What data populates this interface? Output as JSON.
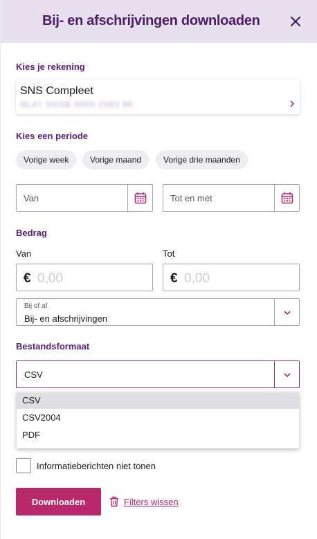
{
  "header": {
    "title": "Bij- en afschrijvingen downloaden",
    "close_icon": "close-icon"
  },
  "account": {
    "section_label": "Kies je rekening",
    "name": "SNS Compleet",
    "number_masked": "NL47 SNSB 0000 2593 86"
  },
  "period": {
    "section_label": "Kies een periode",
    "chips": [
      "Vorige week",
      "Vorige maand",
      "Vorige drie maanden"
    ],
    "from_placeholder": "Van",
    "to_placeholder": "Tot en met"
  },
  "amount": {
    "section_label": "Bedrag",
    "from_label": "Van",
    "to_label": "Tot",
    "currency": "€",
    "from_placeholder": "0,00",
    "to_placeholder": "0,00"
  },
  "direction": {
    "label": "Bij of af",
    "value": "Bij- en afschrijvingen"
  },
  "format": {
    "section_label": "Bestandsformaat",
    "value": "CSV",
    "options": [
      "CSV",
      "CSV2004",
      "PDF"
    ]
  },
  "options": {
    "hide_info_label": "Informatieberichten niet tonen"
  },
  "actions": {
    "download_label": "Downloaden",
    "clear_filters_label": "Filters wissen"
  },
  "colors": {
    "brand_purple": "#5a1e7a",
    "accent_pink": "#b8286a",
    "header_bg": "#e8e0ee"
  }
}
